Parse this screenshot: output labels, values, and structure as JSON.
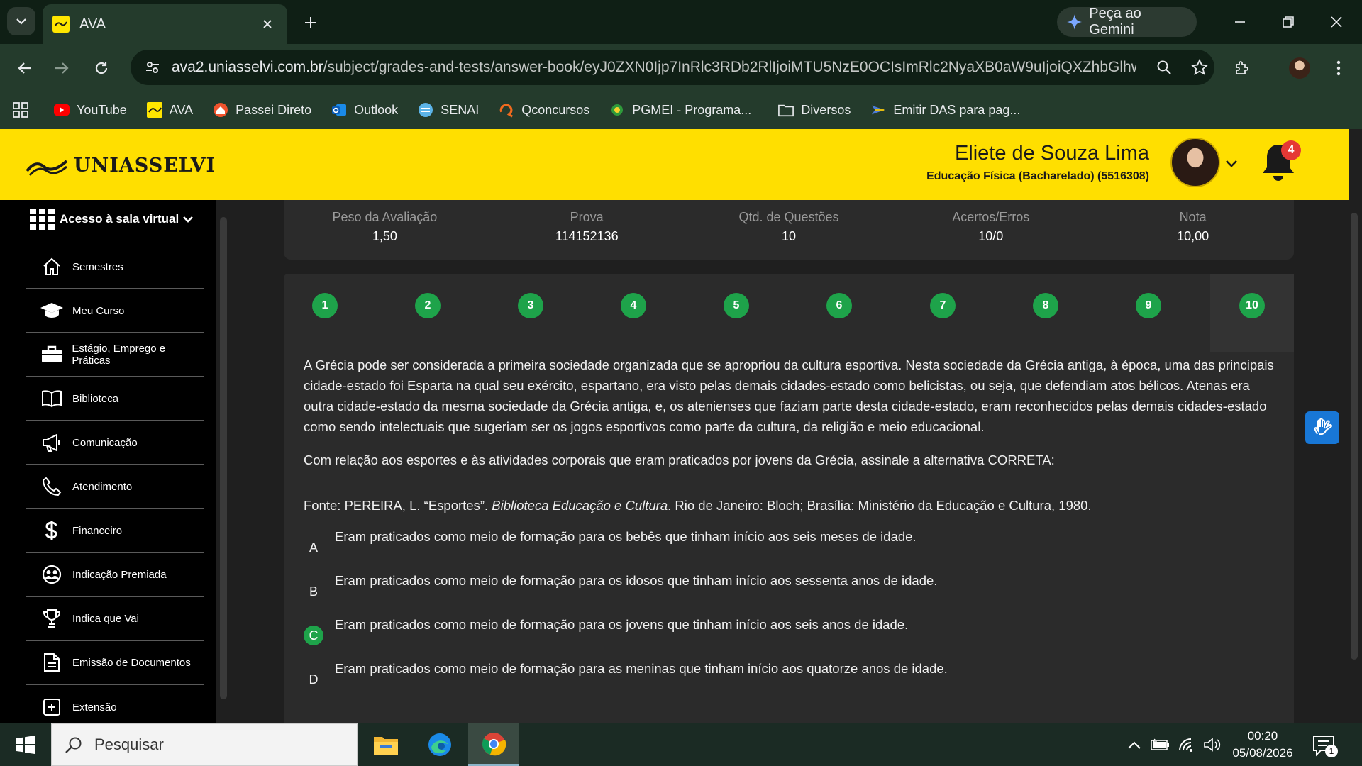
{
  "browser": {
    "tab_title": "AVA",
    "gemini_label": "Peça ao Gemini",
    "url_host": "ava2.uniasselvi.com.br",
    "url_path": "/subject/grades-and-tests/answer-book/eyJ0ZXN0Ijp7InRlc3RDb2RlIjoiMTU5NzE0OCIsImRlc2NyaXB0aW9uIjoiQXZhbGlhw..."
  },
  "bookmarks": [
    {
      "label": "YouTube",
      "icon": "youtube-icon"
    },
    {
      "label": "AVA",
      "icon": "ava-icon"
    },
    {
      "label": "Passei Direto",
      "icon": "passei-direto-icon"
    },
    {
      "label": "Outlook",
      "icon": "outlook-icon"
    },
    {
      "label": "SENAI",
      "icon": "senai-icon"
    },
    {
      "label": "Qconcursos",
      "icon": "qconcursos-icon"
    },
    {
      "label": "PGMEI - Programa...",
      "icon": "pgmei-icon"
    },
    {
      "label": "Diversos",
      "icon": "folder-icon"
    },
    {
      "label": "Emitir DAS para pag...",
      "icon": "das-icon"
    }
  ],
  "header": {
    "logo_text": "UNIASSELVI",
    "user_name": "Eliete de Souza Lima",
    "user_course": "Educação Física (Bacharelado) (5516308)",
    "notification_count": "4"
  },
  "sidebar": {
    "top_label": "Acesso à sala virtual",
    "items": [
      {
        "label": "Semestres",
        "icon": "home-icon"
      },
      {
        "label": "Meu Curso",
        "icon": "graduation-cap-icon"
      },
      {
        "label": "Estágio, Emprego e Práticas",
        "icon": "briefcase-icon"
      },
      {
        "label": "Biblioteca",
        "icon": "book-icon"
      },
      {
        "label": "Comunicação",
        "icon": "megaphone-icon"
      },
      {
        "label": "Atendimento",
        "icon": "phone-icon"
      },
      {
        "label": "Financeiro",
        "icon": "dollar-icon"
      },
      {
        "label": "Indicação Premiada",
        "icon": "people-icon"
      },
      {
        "label": "Indica que Vai",
        "icon": "trophy-icon"
      },
      {
        "label": "Emissão de Documentos",
        "icon": "document-icon"
      },
      {
        "label": "Extensão",
        "icon": "extension-icon"
      }
    ]
  },
  "summary": [
    {
      "label": "Peso da Avaliação",
      "value": "1,50"
    },
    {
      "label": "Prova",
      "value": "114152136"
    },
    {
      "label": "Qtd. de Questões",
      "value": "10"
    },
    {
      "label": "Acertos/Erros",
      "value": "10/0"
    },
    {
      "label": "Nota",
      "value": "10,00"
    }
  ],
  "steps": [
    "1",
    "2",
    "3",
    "4",
    "5",
    "6",
    "7",
    "8",
    "9",
    "10"
  ],
  "question": {
    "paragraph1": "A Grécia pode ser considerada a primeira sociedade organizada que se apropriou da cultura esportiva. Nesta sociedade da Grécia antiga, à época, uma das principais cidade-estado foi Esparta na qual seu exército, espartano, era visto pelas demais cidades-estado como belicistas, ou seja, que defendiam atos bélicos. Atenas era outra cidade-estado da mesma sociedade da Grécia antiga, e, os atenienses que faziam parte desta cidade-estado, eram reconhecidos pelas demais cidades-estado como sendo intelectuais que sugeriam ser os jogos esportivos como parte da cultura, da religião e meio educacional.",
    "paragraph2": "Com relação aos esportes e às atividades corporais que eram praticados por jovens da Grécia, assinale a alternativa CORRETA:",
    "source_prefix": "Fonte: PEREIRA, L. “Esportes”. ",
    "source_italic": "Biblioteca Educação e Cultura",
    "source_suffix": ". Rio de Janeiro: Bloch; Brasília: Ministério da Educação e Cultura, 1980.",
    "alternatives": [
      {
        "letter": "A",
        "text": "Eram praticados como meio de formação para os bebês que tinham início aos seis meses de idade.",
        "correct": false
      },
      {
        "letter": "B",
        "text": "Eram praticados como meio de formação para os idosos que tinham início aos sessenta anos de idade.",
        "correct": false
      },
      {
        "letter": "C",
        "text": "Eram praticados como meio de formação para os jovens que tinham início aos seis anos de idade.",
        "correct": true
      },
      {
        "letter": "D",
        "text": "Eram praticados como meio de formação para as meninas que tinham início aos quatorze anos de idade.",
        "correct": false
      }
    ]
  },
  "taskbar": {
    "search_placeholder": "Pesquisar",
    "time": "00:20",
    "date": "05/08/2026",
    "notification_count": "1"
  },
  "colors": {
    "brand_yellow": "#ffdf00",
    "correct_green": "#1ea34a",
    "chrome_dark": "#243b2c"
  }
}
